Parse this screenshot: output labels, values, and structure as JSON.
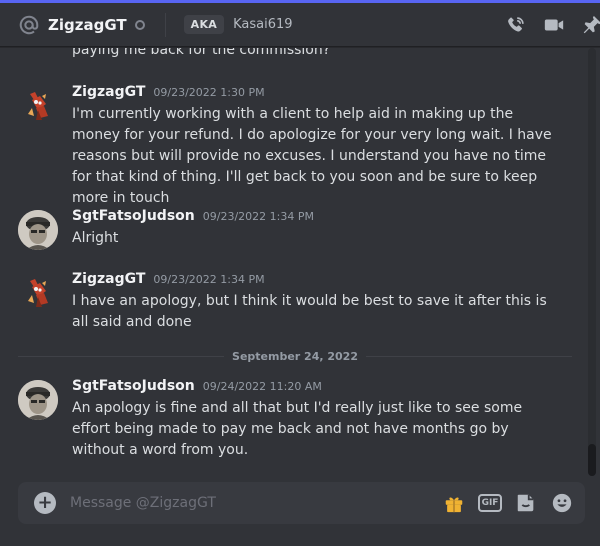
{
  "header": {
    "name": "ZigzagGT",
    "aka_label": "AKA",
    "aka_name": "Kasai619",
    "icons": [
      "at-icon",
      "voice-call-icon",
      "video-call-icon",
      "pin-icon"
    ]
  },
  "messages": [
    {
      "author": "",
      "timestamp": "",
      "text": "paying me  back  for the commission?"
    },
    {
      "author": "ZigzagGT",
      "timestamp": "09/23/2022 1:30 PM",
      "text": "I'm currently working with a client to help aid in making up the money for your refund. I do apologize for your very long wait. I have reasons but will provide no excuses. I understand you have no time for that kind of thing. I'll get back to you soon and be sure to keep more in touch"
    },
    {
      "author": "SgtFatsoJudson",
      "timestamp": "09/23/2022 1:34 PM",
      "text": "Alright"
    },
    {
      "author": "ZigzagGT",
      "timestamp": "09/23/2022 1:34 PM",
      "text": "I have an apology, but I think it would be best to save it after this is all said and done"
    },
    {
      "author": "SgtFatsoJudson",
      "timestamp": "09/24/2022 11:20 AM",
      "text": "An apology is fine and all that but I'd really just like to see some effort being made to pay me back and not have months go by without a word from you."
    }
  ],
  "date_separator": "September 24, 2022",
  "composer": {
    "placeholder": "Message @ZigzagGT",
    "gif_label": "GIF",
    "icons": [
      "add-icon",
      "gift-icon",
      "gif-icon",
      "sticker-icon",
      "emoji-icon"
    ]
  },
  "colors": {
    "background": "#313338",
    "accent": "#5865f2",
    "gift": "#f0b232",
    "emoji": "#b5bac1"
  }
}
